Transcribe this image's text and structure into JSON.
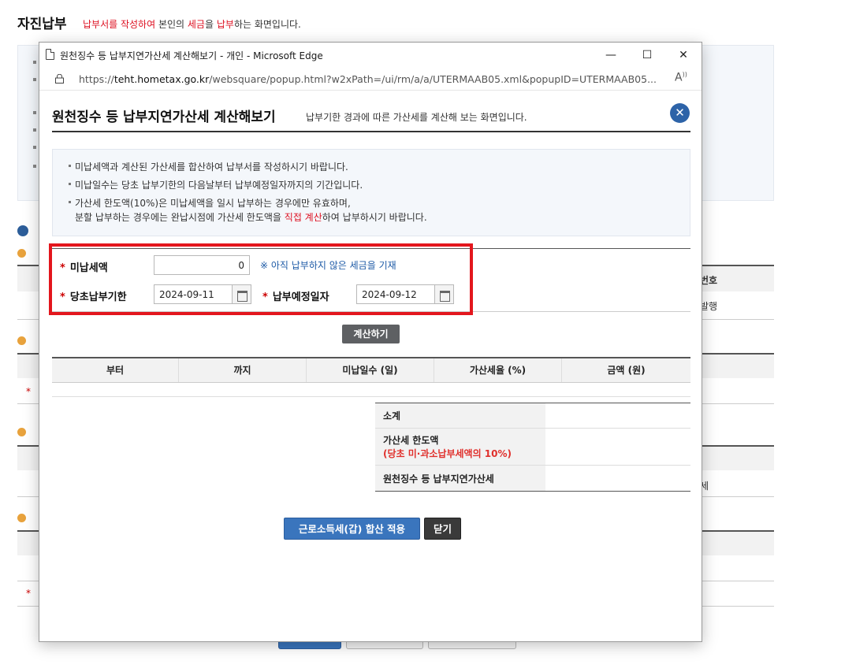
{
  "page": {
    "title": "자진납부",
    "desc_red1": "납부서를 작성하여",
    "desc_mid1": " 본인의 ",
    "desc_red2": "세금",
    "desc_mid2": "을 ",
    "desc_red3": "납부",
    "desc_end": "하는 화면입니다.",
    "right_labels": {
      "header": "번호",
      "cell1": "발행",
      "cell2": "세"
    }
  },
  "window": {
    "title": "원천징수 등 납부지연가산세 계산해보기 - 개인 - Microsoft Edge",
    "url_scheme": "https://",
    "url_host": "teht.hometax.go.kr",
    "url_path": "/websquare/popup.html?w2xPath=/ui/rm/a/a/UTERMAAB05.xml&popupID=UTERMAAB05...",
    "minimize": "—",
    "maximize": "☐",
    "close": "✕",
    "read_aloud": "A̵"
  },
  "popup": {
    "title": "원천징수 등 납부지연가산세 계산해보기",
    "subtitle": "납부기한 경과에 따른 가산세를 계산해 보는 화면입니다.",
    "close_icon": "✕",
    "notice": {
      "line1": "미납세액과 계산된 가산세를 합산하여 납부서를 작성하시기 바랍니다.",
      "line2": "미납일수는 당초 납부기한의 다음날부터 납부예정일자까지의 기간입니다.",
      "line3": "가산세 한도액(10%)은 미납세액을 일시 납부하는 경우에만 유효하며,",
      "line4_a": "분할 납부하는 경우에는 완납시점에 가산세 한도액을 ",
      "line4_red": "직접 계산",
      "line4_b": "하여 납부하시기 바랍니다."
    },
    "form": {
      "unpaid_label": "미납세액",
      "unpaid_value": "0",
      "hint": "※ 아직 납부하지 않은 세금을 기재",
      "orig_due_label": "당초납부기한",
      "orig_due_value": "2024-09-11",
      "planned_label": "납부예정일자",
      "planned_value": "2024-09-12",
      "star": "*"
    },
    "calc_button": "계산하기",
    "result_columns": [
      "부터",
      "까지",
      "미납일수 (일)",
      "가산세율 (%)",
      "금액 (원)"
    ],
    "summary": {
      "subtotal": "소계",
      "limit": "가산세 한도액",
      "limit_note": "(당초 미·과소납부세액의 10%)",
      "total": "원천징수 등 납부지연가산세"
    },
    "apply_button": "근로소득세(갑) 합산 적용",
    "close_button": "닫기"
  }
}
